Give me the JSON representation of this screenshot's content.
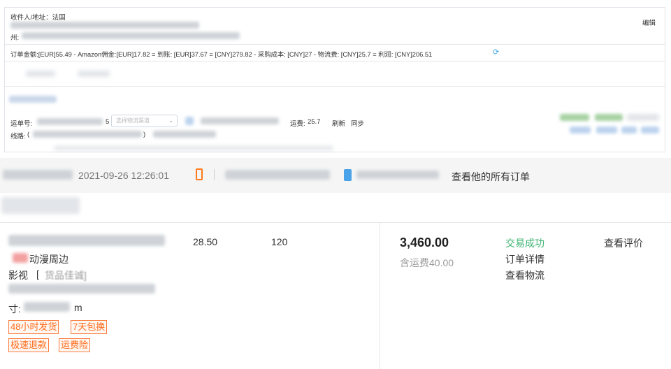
{
  "order_card": {
    "recipient_label": "收件人/地址：法国",
    "state_prefix": "州:",
    "edit_link": "编辑",
    "finance_line": "订单金额:[EUR]55.49 - Amazon佣金:[EUR]17.82 = 到账: [EUR]37.67 = [CNY]279.82 - 采购成本: [CNY]27 - 物流费: [CNY]25.7 = 利润: [CNY]206.51",
    "tracking_label": "运单号:",
    "tracking_suffix": "5",
    "carrier_select_placeholder": "选择物流渠道",
    "shipping_fee_label": "运费:",
    "shipping_fee_value": "25.7",
    "refresh_link": "刷新",
    "sync_link": "同步",
    "route_label": "线路:",
    "route_open": "(",
    "route_close": ")"
  },
  "purchase_card": {
    "order_time": "2021-09-26 12:26:01",
    "view_all_orders": "查看他的所有订单",
    "item_subtitle": "动漫周边",
    "item_spec_prefix": "影视",
    "item_spec_mid": "[",
    "item_spec_tail": "货品佳诚]",
    "size_label": "寸:",
    "size_unit": "m",
    "unit_price": "28.50",
    "quantity": "120",
    "total": "3,460.00",
    "shipping_included": "含运费40.00",
    "status": "交易成功",
    "order_detail_link": "订单详情",
    "logistics_link": "查看物流",
    "review_link": "查看评价",
    "service_tags": [
      "48小时发货",
      "7天包换",
      "极速退款",
      "运费险"
    ]
  },
  "colors": {
    "link": "#2a6fd6",
    "success": "#3cb371",
    "tag": "#ff6a1a",
    "refresh_icon": "#3da5e0",
    "phone_icon": "#ff7a1a",
    "shop_icon": "#4aa3e8"
  }
}
